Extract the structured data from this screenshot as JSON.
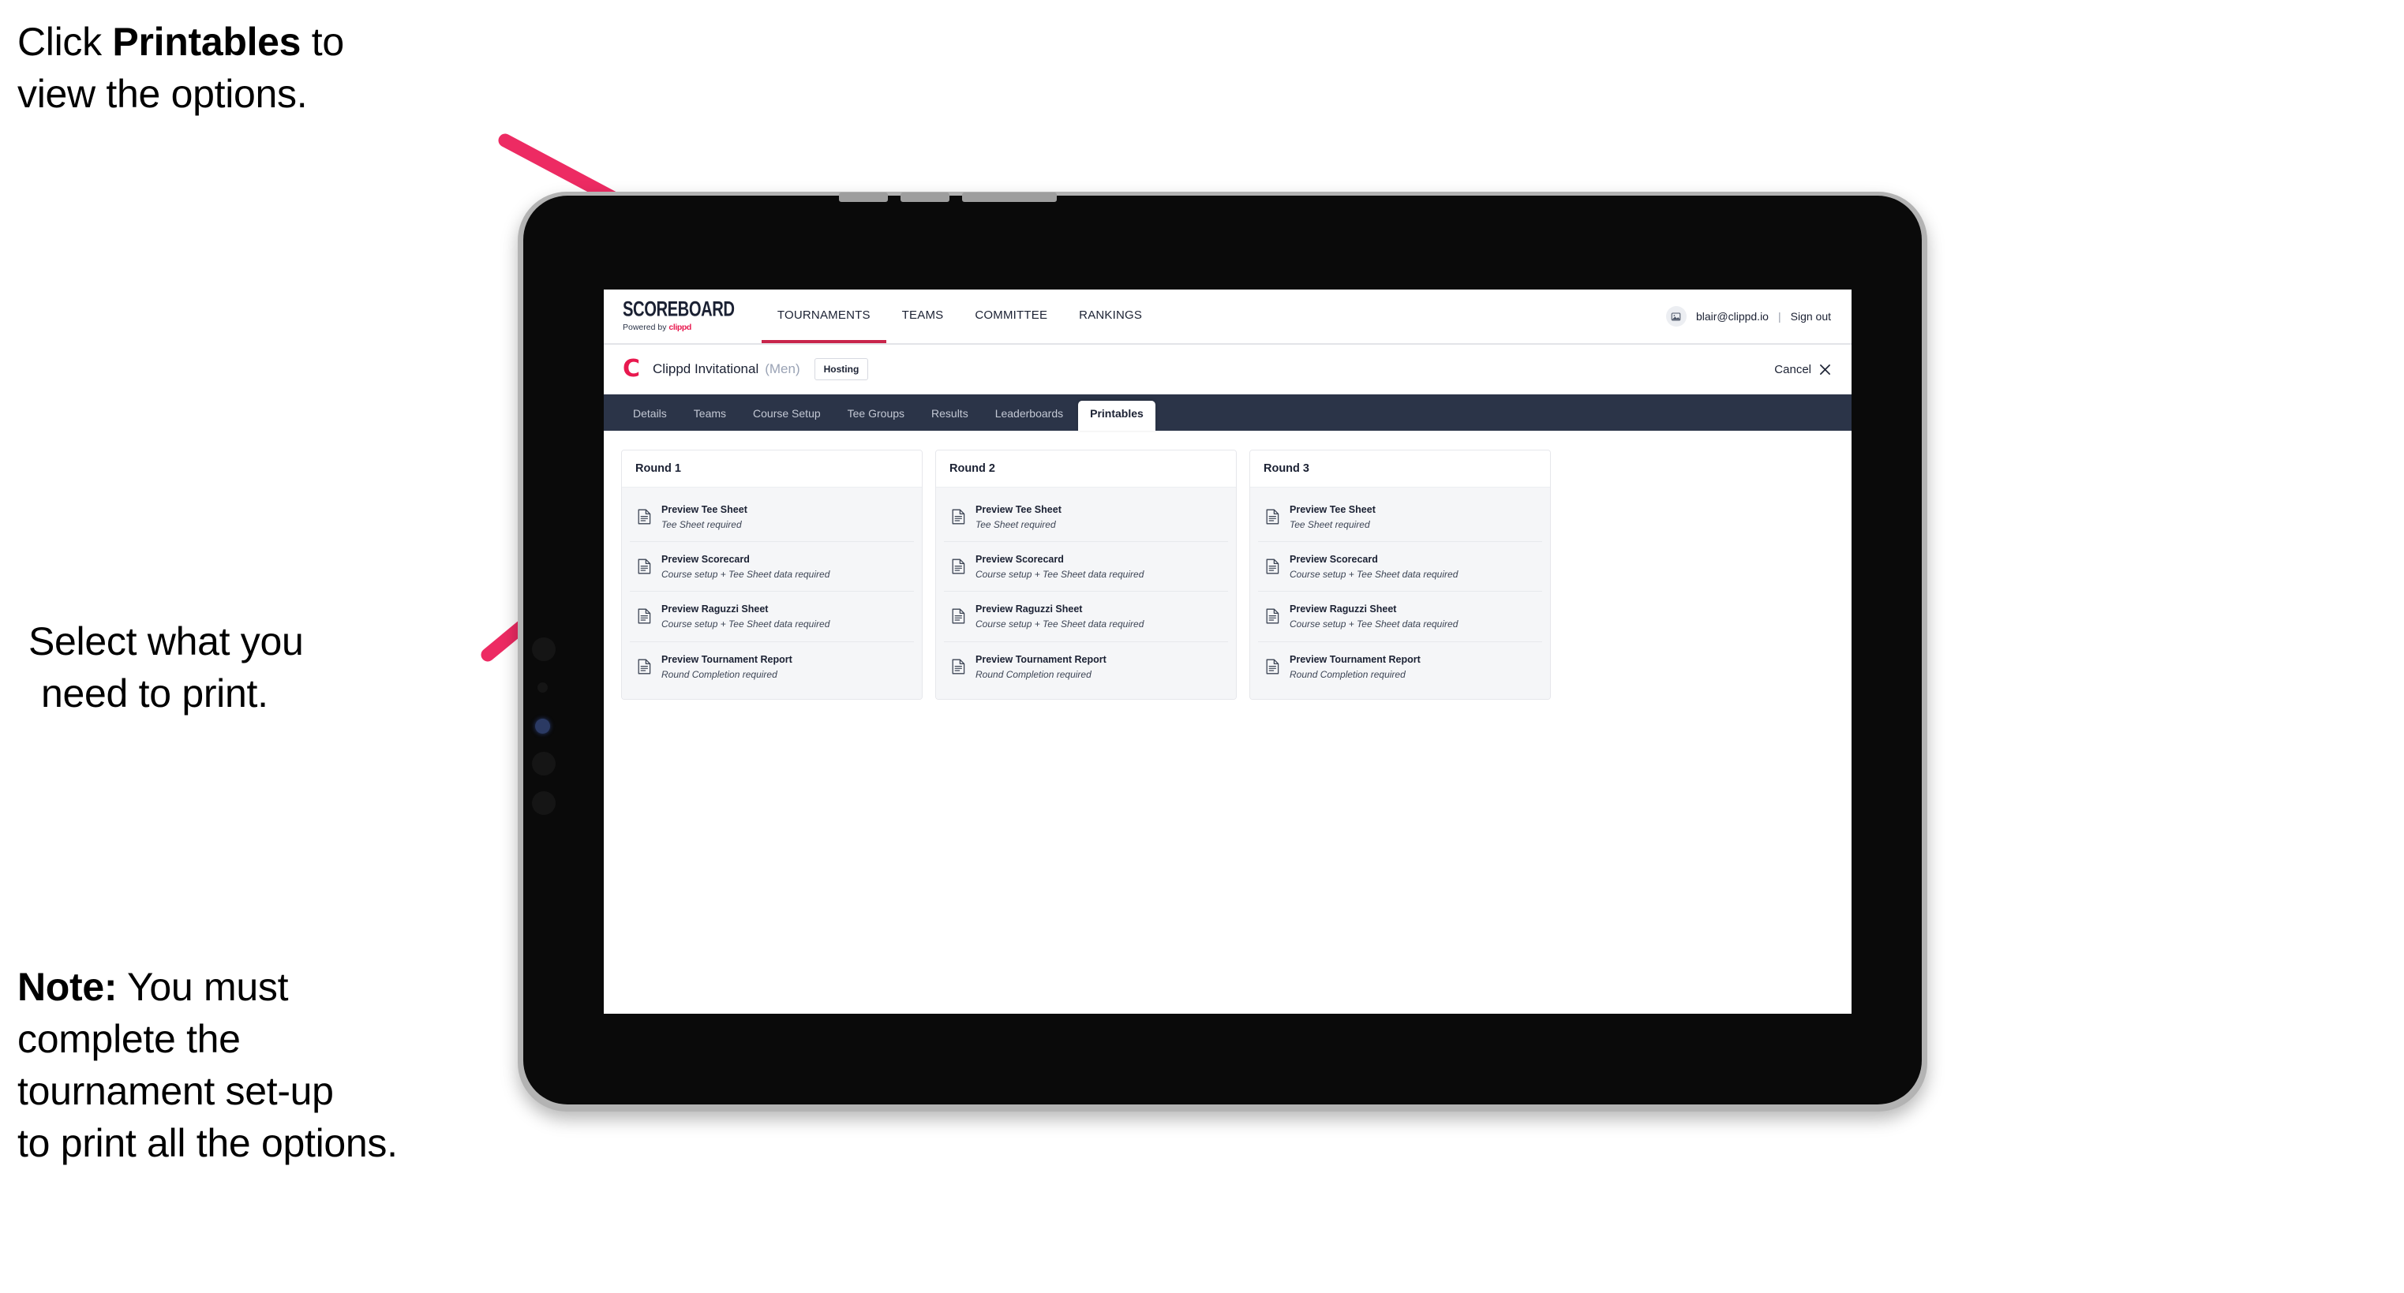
{
  "annotations": {
    "printables_callout": {
      "prefix": "Click ",
      "bold": "Printables",
      "suffix": " to\nview the options."
    },
    "select_callout": {
      "line1": "Select what you",
      "line2": "need to print."
    },
    "note_callout": {
      "bold": "Note:",
      "text": " You must\ncomplete the\ntournament set-up\nto print all the options."
    },
    "arrow_color": "#ED2B63"
  },
  "app": {
    "brand": {
      "wordmark": "SCOREBOARD",
      "powered_prefix": "Powered by ",
      "powered_mark": "clippd"
    },
    "top_nav": [
      {
        "label": "TOURNAMENTS",
        "active": true
      },
      {
        "label": "TEAMS",
        "active": false
      },
      {
        "label": "COMMITTEE",
        "active": false
      },
      {
        "label": "RANKINGS",
        "active": false
      }
    ],
    "account": {
      "avatar_icon": "user-image-icon",
      "email": "blair@clippd.io",
      "separator": "|",
      "sign_out": "Sign out"
    },
    "tournament_bar": {
      "logo_letter": "C",
      "name": "Clippd Invitational",
      "gender": "(Men)",
      "status_badge": "Hosting",
      "cancel_label": "Cancel",
      "close_icon": "close-icon"
    },
    "tabs": [
      {
        "label": "Details",
        "active": false
      },
      {
        "label": "Teams",
        "active": false
      },
      {
        "label": "Course Setup",
        "active": false
      },
      {
        "label": "Tee Groups",
        "active": false
      },
      {
        "label": "Results",
        "active": false
      },
      {
        "label": "Leaderboards",
        "active": false
      },
      {
        "label": "Printables",
        "active": true
      }
    ],
    "colors": {
      "tabstrip_bg": "#2B3448",
      "accent_red": "#C8254B",
      "clippd_pink": "#E8194F"
    },
    "rounds": [
      {
        "title": "Round 1",
        "items": [
          {
            "title": "Preview Tee Sheet",
            "requirement": "Tee Sheet required"
          },
          {
            "title": "Preview Scorecard",
            "requirement": "Course setup + Tee Sheet data required"
          },
          {
            "title": "Preview Raguzzi Sheet",
            "requirement": "Course setup + Tee Sheet data required"
          },
          {
            "title": "Preview Tournament Report",
            "requirement": "Round Completion required"
          }
        ]
      },
      {
        "title": "Round 2",
        "items": [
          {
            "title": "Preview Tee Sheet",
            "requirement": "Tee Sheet required"
          },
          {
            "title": "Preview Scorecard",
            "requirement": "Course setup + Tee Sheet data required"
          },
          {
            "title": "Preview Raguzzi Sheet",
            "requirement": "Course setup + Tee Sheet data required"
          },
          {
            "title": "Preview Tournament Report",
            "requirement": "Round Completion required"
          }
        ]
      },
      {
        "title": "Round 3",
        "items": [
          {
            "title": "Preview Tee Sheet",
            "requirement": "Tee Sheet required"
          },
          {
            "title": "Preview Scorecard",
            "requirement": "Course setup + Tee Sheet data required"
          },
          {
            "title": "Preview Raguzzi Sheet",
            "requirement": "Course setup + Tee Sheet data required"
          },
          {
            "title": "Preview Tournament Report",
            "requirement": "Round Completion required"
          }
        ]
      }
    ]
  }
}
